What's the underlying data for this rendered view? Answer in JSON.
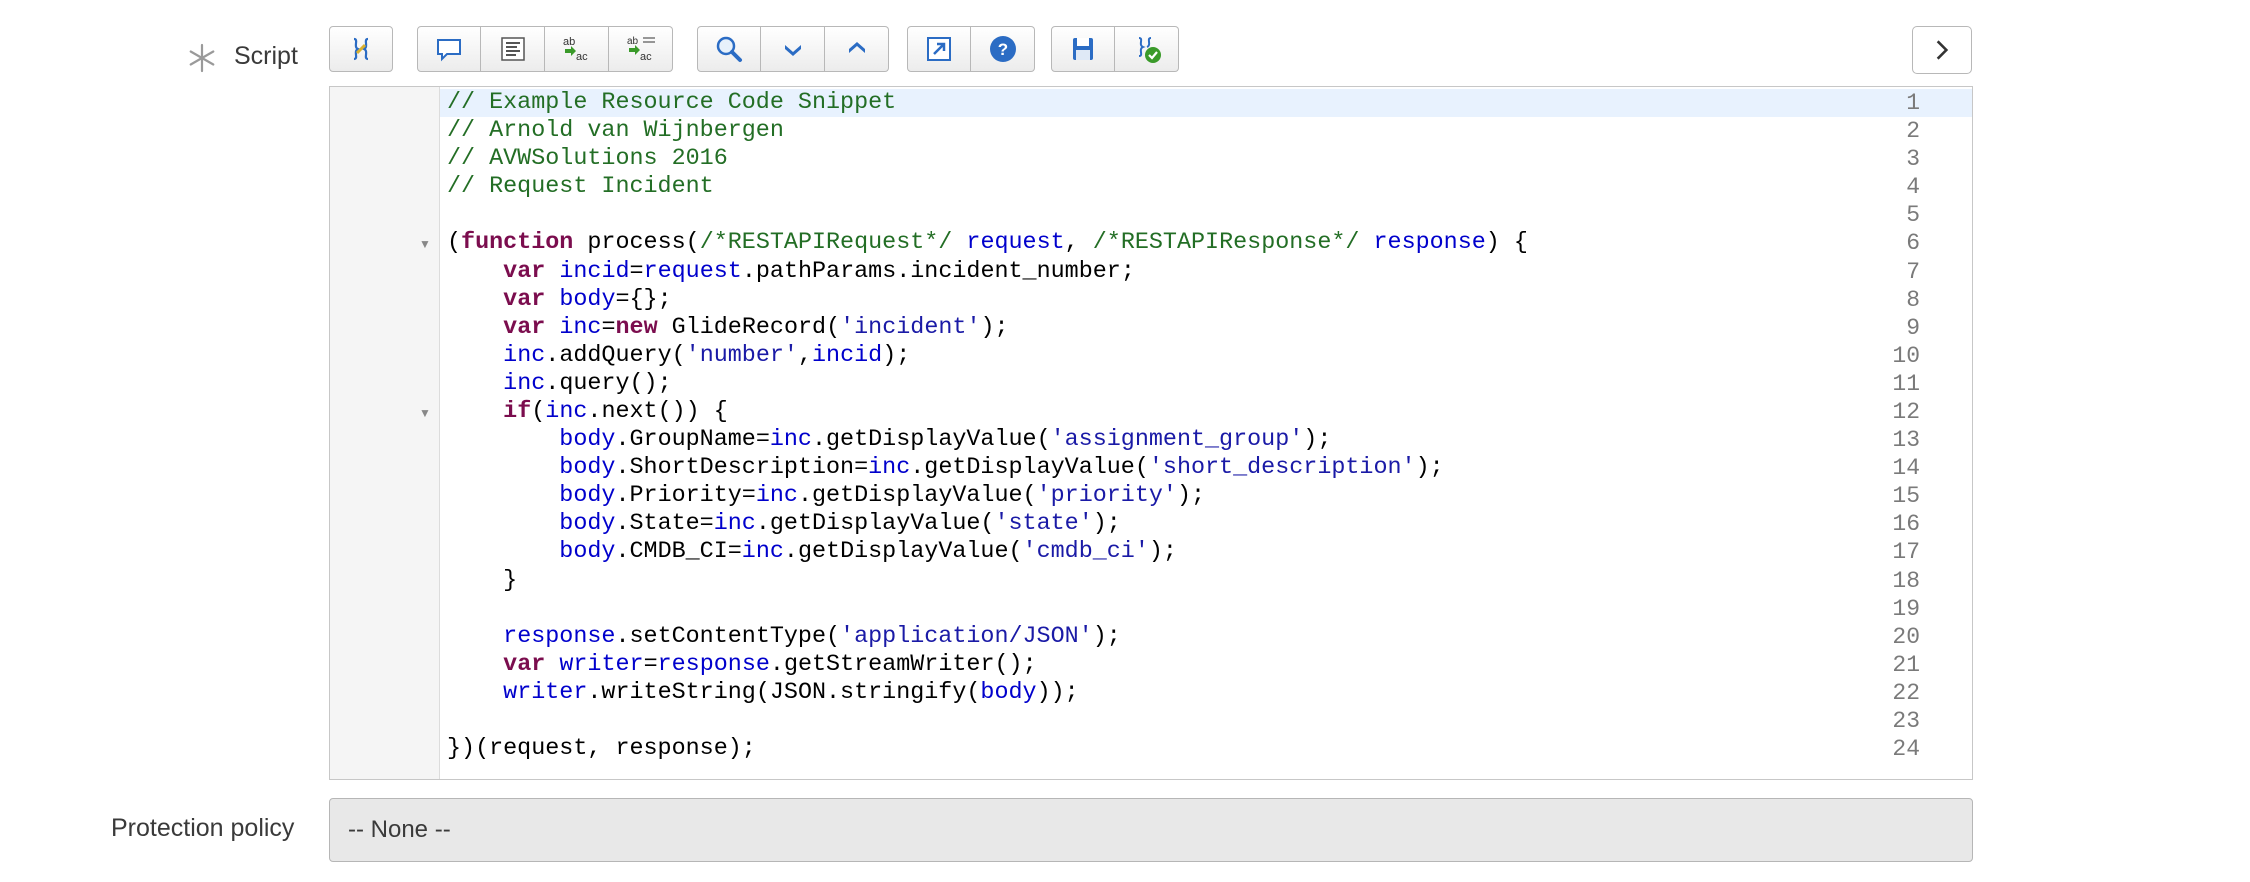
{
  "script_field": {
    "label": "Script",
    "required_icon": "asterisk-icon",
    "toolbar": [
      {
        "group": "format",
        "buttons": [
          {
            "icon": "format-script-icon"
          }
        ]
      },
      {
        "group": "comments",
        "buttons": [
          {
            "icon": "comment-icon"
          },
          {
            "icon": "align-icon"
          },
          {
            "icon": "replace-icon"
          },
          {
            "icon": "replace-all-icon"
          }
        ]
      },
      {
        "group": "search",
        "buttons": [
          {
            "icon": "search-icon"
          },
          {
            "icon": "chevron-down-icon"
          },
          {
            "icon": "chevron-up-icon"
          }
        ]
      },
      {
        "group": "tools",
        "buttons": [
          {
            "icon": "fullscreen-icon"
          },
          {
            "icon": "help-icon"
          }
        ]
      },
      {
        "group": "save",
        "buttons": [
          {
            "icon": "save-icon"
          },
          {
            "icon": "syntax-check-icon"
          }
        ]
      }
    ],
    "next_icon": "chevron-right-icon",
    "code_lines": [
      "// Example Resource Code Snippet",
      "// Arnold van Wijnbergen",
      "// AVWSolutions 2016",
      "// Request Incident",
      "",
      "(function process(/*RESTAPIRequest*/ request, /*RESTAPIResponse*/ response) {",
      "    var incid=request.pathParams.incident_number;",
      "    var body={};",
      "    var inc=new GlideRecord('incident');",
      "    inc.addQuery('number',incid);",
      "    inc.query();",
      "    if(inc.next()) {",
      "        body.GroupName=inc.getDisplayValue('assignment_group');",
      "        body.ShortDescription=inc.getDisplayValue('short_description');",
      "        body.Priority=inc.getDisplayValue('priority');",
      "        body.State=inc.getDisplayValue('state');",
      "        body.CMDB_CI=inc.getDisplayValue('cmdb_ci');",
      "    }",
      "",
      "    response.setContentType('application/JSON');",
      "    var writer=response.getStreamWriter();",
      "    writer.writeString(JSON.stringify(body));",
      "",
      "})(request, response);"
    ],
    "line_numbers": [
      "1",
      "2",
      "3",
      "4",
      "5",
      "6",
      "7",
      "8",
      "9",
      "10",
      "11",
      "12",
      "13",
      "14",
      "15",
      "16",
      "17",
      "18",
      "19",
      "20",
      "21",
      "22",
      "23",
      "24"
    ],
    "fold_markers": [
      "6",
      "12"
    ],
    "active_line": "1"
  },
  "protection_policy": {
    "label": "Protection policy",
    "value": "-- None --"
  }
}
